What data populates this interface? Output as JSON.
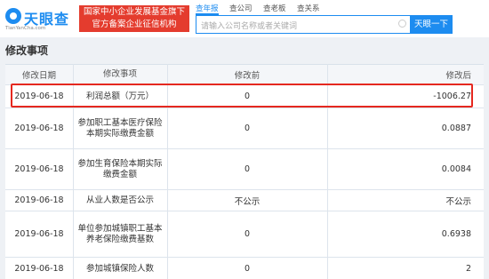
{
  "header": {
    "logo_text": "天眼查",
    "logo_sub": "TianYanCha.com",
    "banner_line1": "国家中小企业发展基金旗下",
    "banner_line2": "官方备案企业征信机构",
    "nav": [
      "查年报",
      "查公司",
      "查老板",
      "查关系"
    ],
    "nav_active": 0,
    "search_placeholder": "请输入公司名称或者关键词",
    "search_button": "天眼一下"
  },
  "section_title": "修改事项",
  "table": {
    "columns": [
      "修改日期",
      "修改事项",
      "修改前",
      "修改后"
    ],
    "rows": [
      {
        "date": "2019-06-18",
        "item": "利润总额（万元）",
        "before": "0",
        "after": "-1006.27"
      },
      {
        "date": "2019-06-18",
        "item": "参加职工基本医疗保险本期实际缴费金额",
        "before": "0",
        "after": "0.0887"
      },
      {
        "date": "2019-06-18",
        "item": "参加生育保险本期实际缴费金额",
        "before": "0",
        "after": "0.0084"
      },
      {
        "date": "2019-06-18",
        "item": "从业人数是否公示",
        "before": "不公示",
        "after": "不公示"
      },
      {
        "date": "2019-06-18",
        "item": "单位参加城镇职工基本养老保险缴费基数",
        "before": "0",
        "after": "0.6938"
      },
      {
        "date": "2019-06-18",
        "item": "参加城镇保险人数",
        "before": "0",
        "after": "2"
      }
    ],
    "highlighted_row": 0,
    "highlight_color": "#e5281f"
  },
  "colors": {
    "brand": "#1d8cf0",
    "banner": "#e43c2e"
  }
}
